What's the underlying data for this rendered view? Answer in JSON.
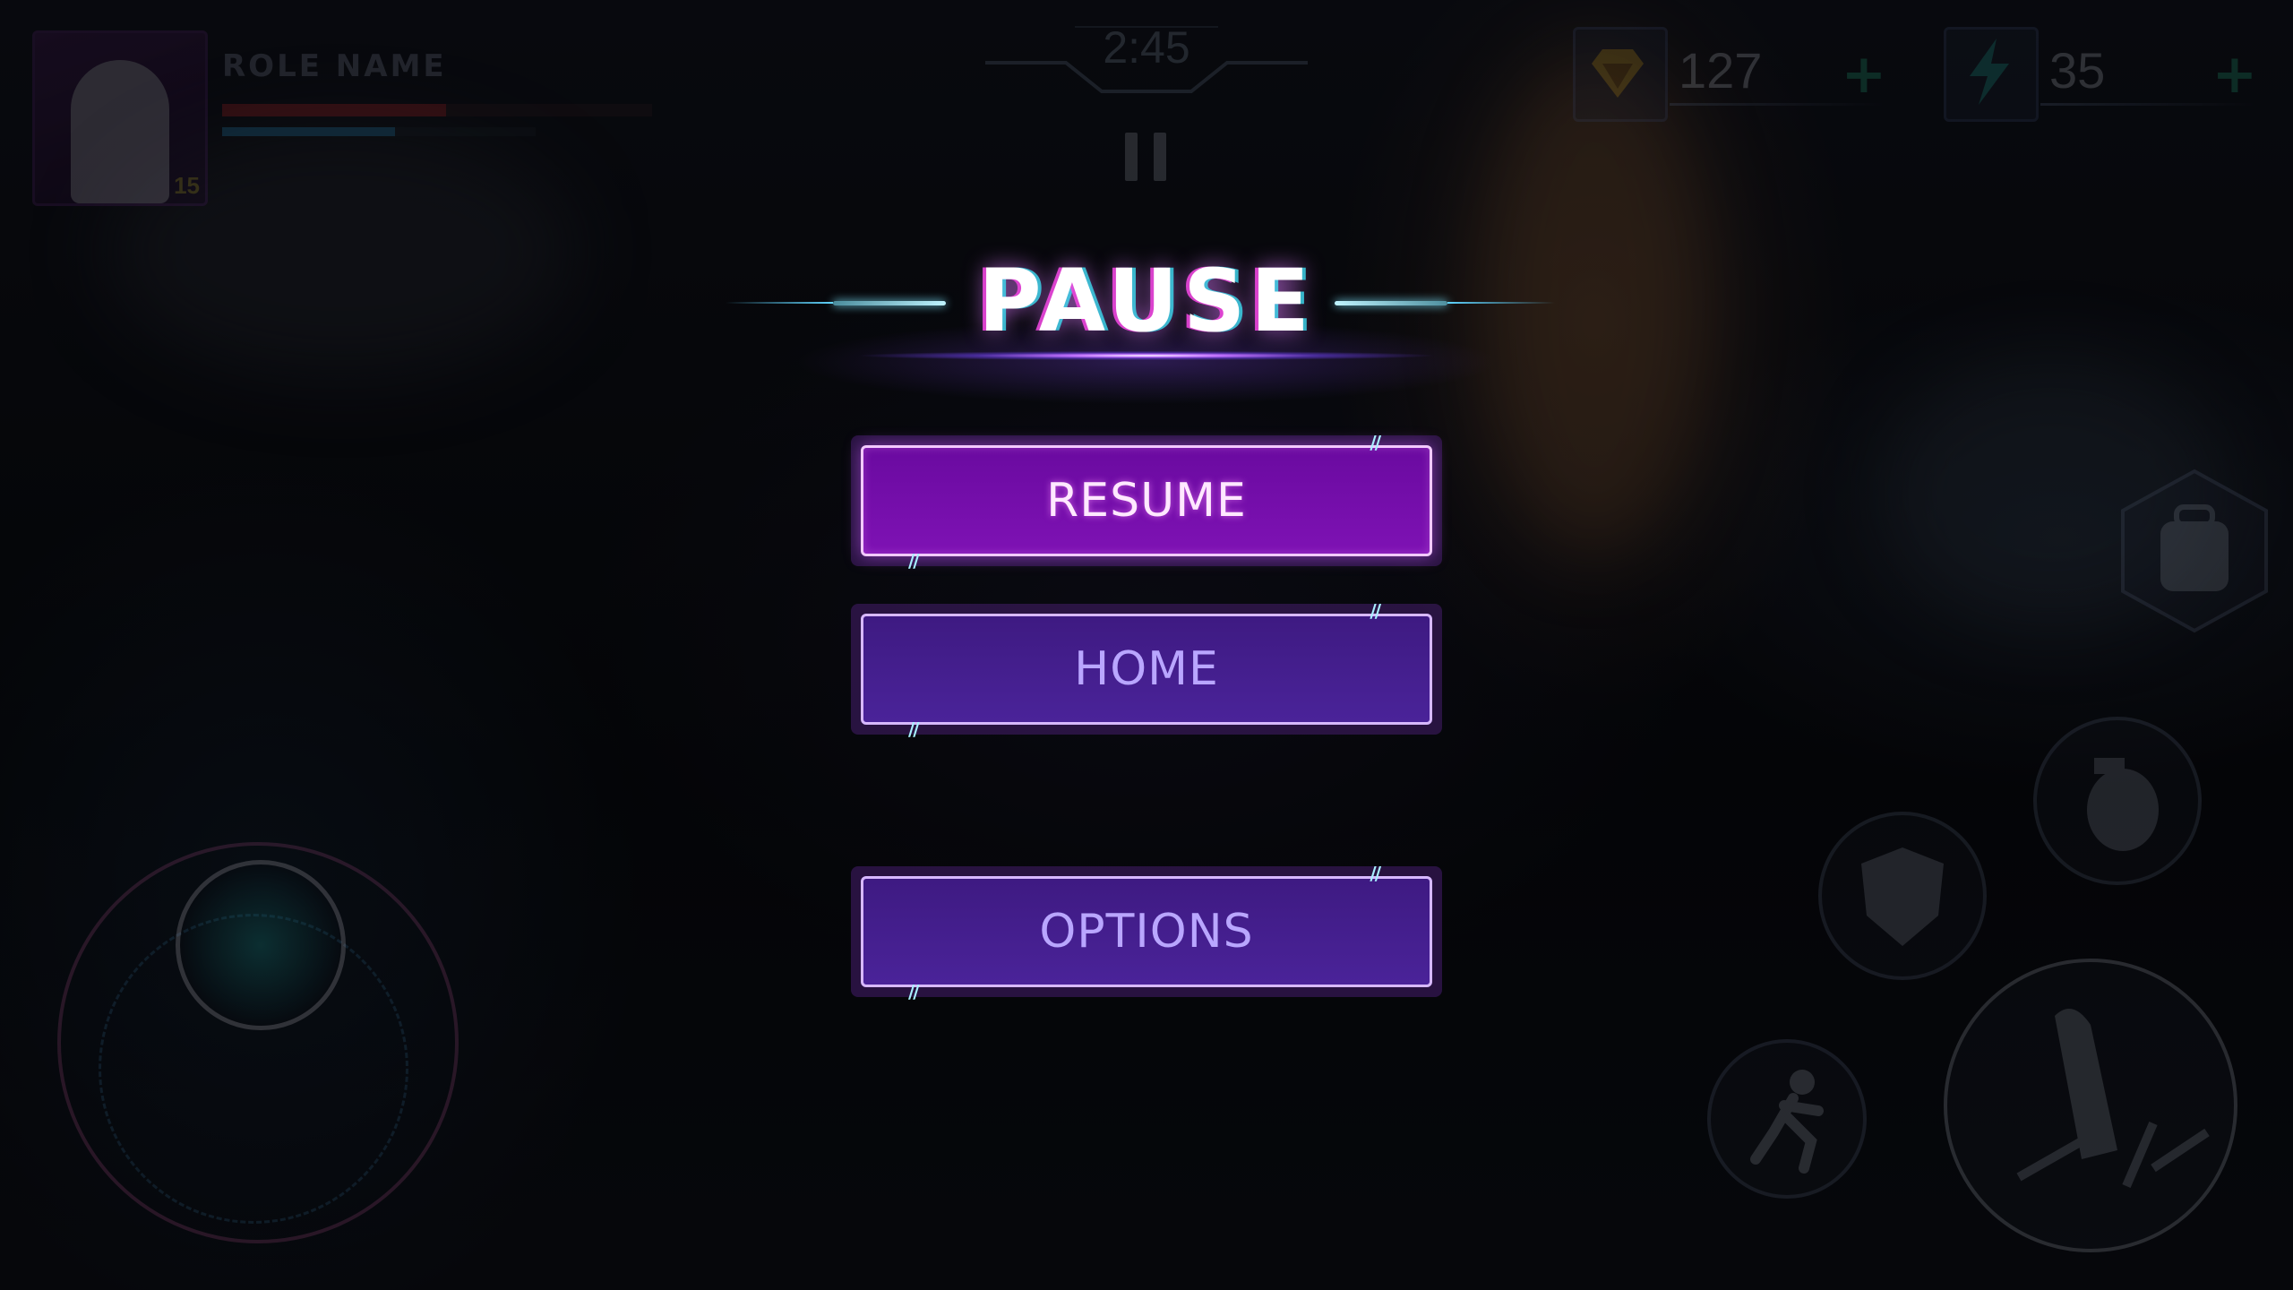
{
  "hud": {
    "role_name": "ROLE NAME",
    "level": "15",
    "timer": "2:45",
    "gems": "127",
    "energy": "35",
    "plus": "+",
    "health_fraction": 0.52,
    "mana_fraction": 0.55
  },
  "pause": {
    "title": "PAUSE",
    "resume_label": "RESUME",
    "home_label": "HOME",
    "options_label": "OPTIONS"
  },
  "colors": {
    "title_accent": "#ff4fe0",
    "active_button": "#7a10b0",
    "button": "#45209a",
    "button_border": "#d7b8ff"
  },
  "icons": [
    "gem-icon",
    "lightning-icon",
    "pause-icon",
    "backpack-icon",
    "grenade-icon",
    "shield-icon",
    "sprint-icon",
    "bullet-icon",
    "joystick"
  ]
}
